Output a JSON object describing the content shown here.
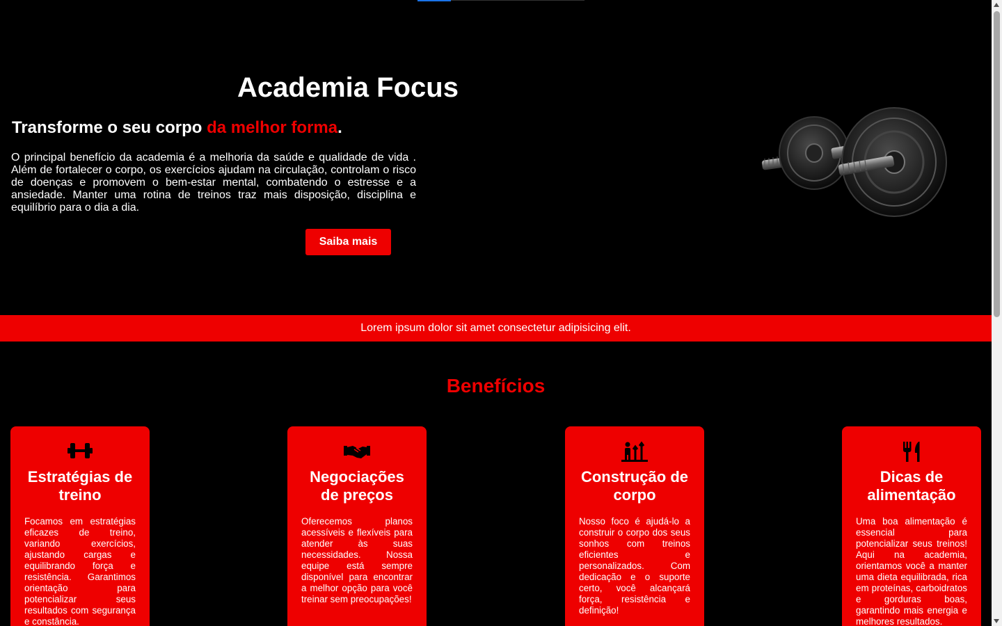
{
  "hero": {
    "title": "Academia Focus",
    "subtitle_start": "Transforme o seu corpo ",
    "subtitle_accent": "da melhor forma",
    "subtitle_end": ".",
    "text": "O principal benefício da academia é a melhoria da saúde e qualidade de vida . Além de fortalecer o corpo, os exercícios ajudam na circulação, controlam o risco de doenças e promovem o bem-estar mental, combatendo o estresse e a ansiedade. Manter uma rotina de treinos traz mais disposição, disciplina e equilíbrio para o dia a dia.",
    "cta_label": "Saiba mais",
    "image_icon": "dumbbell-icon"
  },
  "banner": {
    "text": "Lorem ipsum dolor sit amet consectetur adipisicing elit."
  },
  "benefits": {
    "title": "Benefícios",
    "cards": [
      {
        "icon": "dumbbell-icon",
        "title": "Estratégias de treino",
        "text": "Focamos em estratégias eficazes de treino, variando exercícios, ajustando cargas e equilibrando força e resistência. Garantimos orientação para potencializar seus resultados com segurança e constância."
      },
      {
        "icon": "handshake-icon",
        "title": "Negociações de preços",
        "text": "Oferecemos planos acessíveis e flexíveis para atender às suas necessidades. Nossa equipe está sempre disponível para encontrar a melhor opção para você treinar sem preocupações!"
      },
      {
        "icon": "body-growth-icon",
        "title": "Construção de corpo",
        "text": "Nosso foco é ajudá-lo a construir o corpo dos seus sonhos com treinos eficientes e personalizados. Com dedicação e o suporte certo, você alcançará força, resistência e definição!"
      },
      {
        "icon": "utensils-icon",
        "title": "Dicas de alimentação",
        "text": "Uma boa alimentação é essencial para potencializar seus treinos! Aqui na academia, orientamos você a manter uma dieta equilibrada, rica em proteínas, carboidratos e gorduras boas, garantindo mais energia e melhores resultados."
      }
    ]
  },
  "colors": {
    "accent": "#ee0000",
    "background": "#000000",
    "text": "#ffffff"
  }
}
